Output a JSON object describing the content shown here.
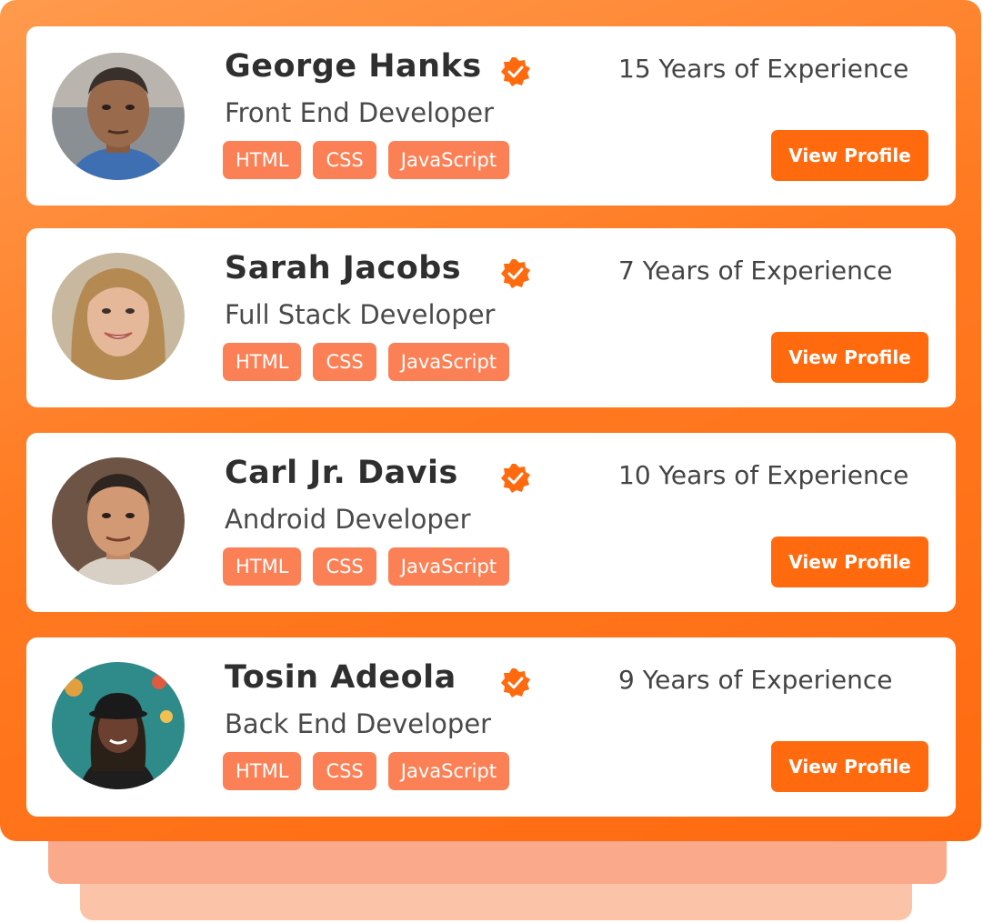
{
  "theme": {
    "accent": "#ff6a0f",
    "tag_color": "#fb8056",
    "badge_color": "#ff6a0f"
  },
  "developers": [
    {
      "name": "George Hanks",
      "role": "Front End Developer",
      "experience": "15 Years of Experience",
      "skills": [
        "HTML",
        "CSS",
        "JavaScript"
      ],
      "button_label": "View Profile",
      "verified_icon": "verified-badge-icon"
    },
    {
      "name": "Sarah Jacobs",
      "role": "Full Stack Developer",
      "experience": "7 Years of Experience",
      "skills": [
        "HTML",
        "CSS",
        "JavaScript"
      ],
      "button_label": "View Profile",
      "verified_icon": "verified-badge-icon"
    },
    {
      "name": "Carl Jr. Davis",
      "role": "Android Developer",
      "experience": "10 Years of Experience",
      "skills": [
        "HTML",
        "CSS",
        "JavaScript"
      ],
      "button_label": "View Profile",
      "verified_icon": "verified-badge-icon"
    },
    {
      "name": "Tosin Adeola",
      "role": "Back End Developer",
      "experience": "9 Years of Experience",
      "skills": [
        "HTML",
        "CSS",
        "JavaScript"
      ],
      "button_label": "View Profile",
      "verified_icon": "verified-badge-icon"
    }
  ]
}
